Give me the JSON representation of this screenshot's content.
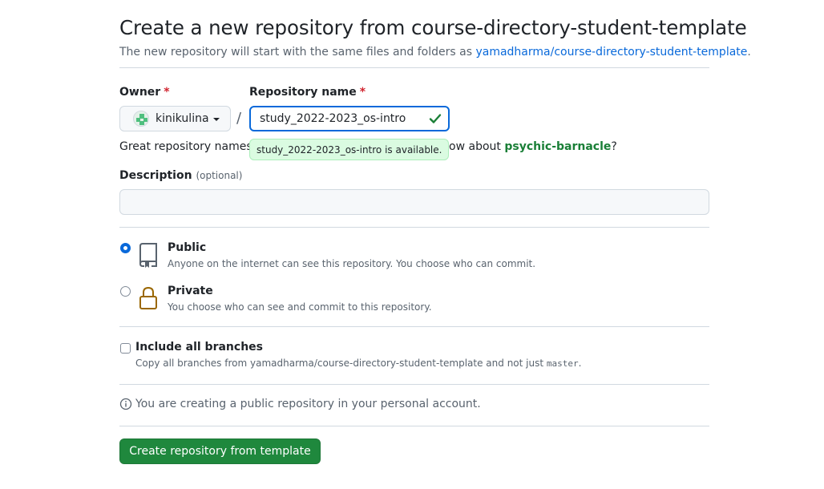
{
  "header": {
    "title": "Create a new repository from course-directory-student-template",
    "subtitle_prefix": "The new repository will start with the same files and folders as ",
    "template_link": "yamadharma/course-directory-student-template",
    "subtitle_suffix": "."
  },
  "owner": {
    "label": "Owner",
    "required_mark": "*",
    "value": "kinikulina"
  },
  "separator": "/",
  "repo_name": {
    "label": "Repository name",
    "required_mark": "*",
    "value": "study_2022-2023_os-intro",
    "availability": "study_2022-2023_os-intro is available."
  },
  "name_hint": {
    "prefix": "Great repository names a",
    "middle": "piration? How about ",
    "suggestion": "psychic-barnacle",
    "suffix": "?"
  },
  "description": {
    "label": "Description",
    "optional": "(optional)",
    "value": ""
  },
  "visibility": {
    "public": {
      "title": "Public",
      "note": "Anyone on the internet can see this repository. You choose who can commit.",
      "selected": true
    },
    "private": {
      "title": "Private",
      "note": "You choose who can see and commit to this repository.",
      "selected": false
    }
  },
  "branches": {
    "title": "Include all branches",
    "note_prefix": "Copy all branches from yamadharma/course-directory-student-template and not just ",
    "note_code": "master",
    "note_suffix": ".",
    "checked": false
  },
  "info": "You are creating a public repository in your personal account.",
  "submit_label": "Create repository from template",
  "colors": {
    "accent": "#0969da",
    "success": "#1a7f37",
    "button": "#1f883d",
    "lock": "#9a6700"
  }
}
